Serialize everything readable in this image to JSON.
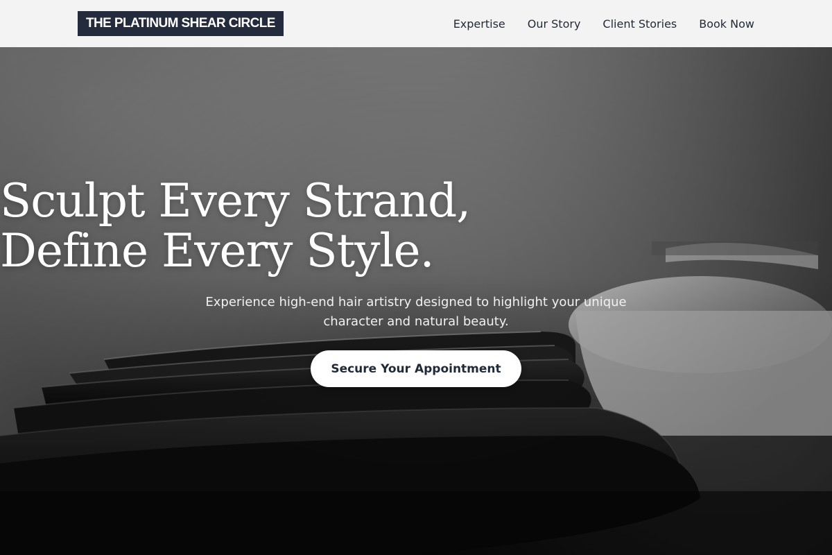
{
  "header": {
    "logo": "THE PLATINUM SHEAR CIRCLE",
    "nav": [
      {
        "label": "Expertise"
      },
      {
        "label": "Our Story"
      },
      {
        "label": "Client Stories"
      },
      {
        "label": "Book Now"
      }
    ]
  },
  "hero": {
    "title_line1": "Sculpt Every Strand,",
    "title_line2": "Define Every Style.",
    "subtitle": "Experience high-end hair artistry designed to highlight your unique character and natural beauty.",
    "cta_label": "Secure Your Appointment"
  },
  "colors": {
    "header_bg": "#f3f3f3",
    "logo_bg": "#232b3d",
    "logo_text": "#ffffff",
    "nav_text": "#1f2937",
    "cta_bg": "#ffffff",
    "cta_text": "#1f2937"
  }
}
